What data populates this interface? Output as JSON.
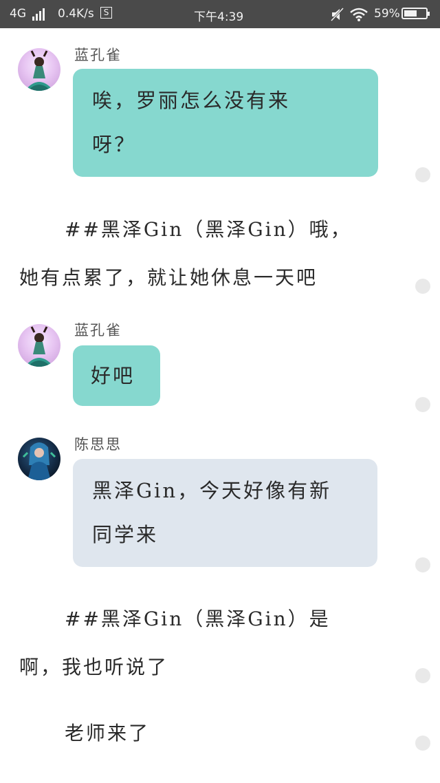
{
  "status_bar": {
    "network": "4G",
    "speed": "0.4K/s",
    "sim_icon": "S",
    "time": "下午4:39",
    "battery_percent": "59%",
    "battery_level": 0.59
  },
  "messages": [
    {
      "sender": "蓝孔雀",
      "lines": [
        "唉，罗丽怎么没有来",
        "呀？"
      ]
    },
    {
      "sender": "蓝孔雀",
      "lines": [
        "好吧"
      ]
    },
    {
      "sender": "陈思思",
      "lines": [
        "黑泽Gin，今天好像有新",
        "同学来"
      ]
    }
  ],
  "narration": [
    {
      "lines": [
        "##黑泽Gin（黑泽Gin）哦，",
        "她有点累了，就让她休息一天吧"
      ]
    },
    {
      "lines": [
        "##黑泽Gin（黑泽Gin）是",
        "啊，我也听说了",
        "老师来了"
      ]
    }
  ],
  "icons": {
    "signal": "signal-icon",
    "mute": "mute-icon",
    "wifi": "wifi-icon",
    "battery": "battery-icon"
  },
  "colors": {
    "statusbar": "#4a4a4a",
    "bubble_teal": "#86d8cf",
    "bubble_grey": "#dfe6ee"
  }
}
